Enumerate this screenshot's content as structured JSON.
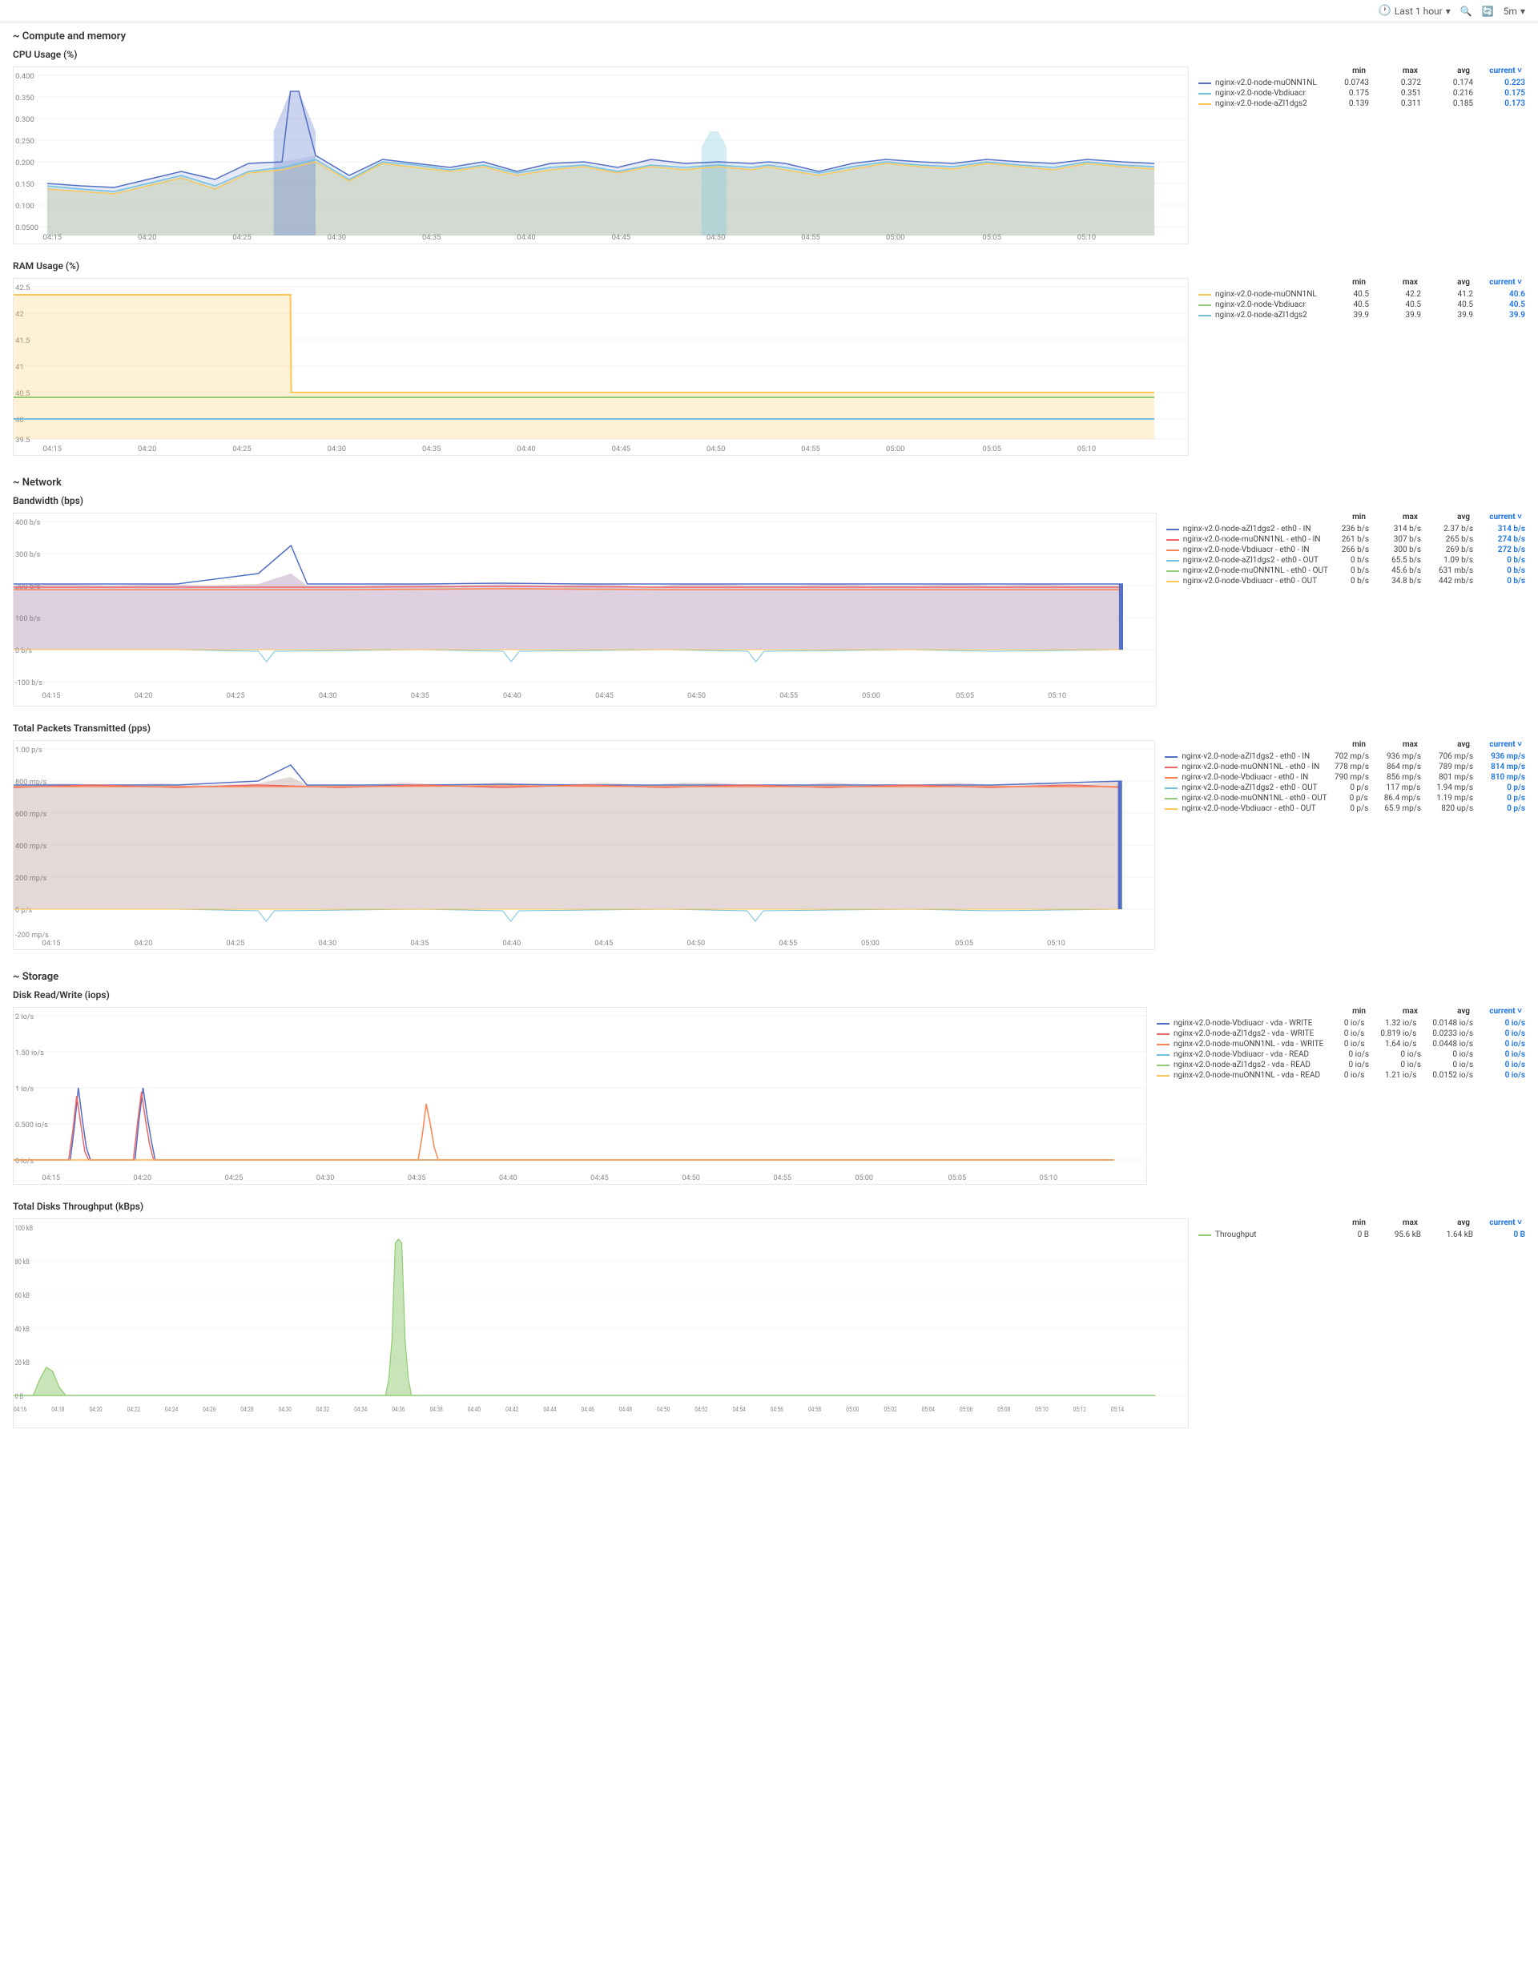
{
  "topbar": {
    "time_icon": "🕐",
    "time_label": "Last 1 hour",
    "search_icon": "🔍",
    "refresh_icon": "🔄",
    "interval_label": "5m",
    "dropdown_icon": "▾"
  },
  "sections": {
    "compute": "~ Compute and memory",
    "network": "~ Network",
    "storage": "~ Storage"
  },
  "cpu": {
    "title": "CPU Usage (%)",
    "y_labels": [
      "0.400",
      "0.350",
      "0.300",
      "0.250",
      "0.200",
      "0.150",
      "0.100",
      "0.0500"
    ],
    "x_labels": [
      "04:15",
      "04:20",
      "04:25",
      "04:30",
      "04:35",
      "04:40",
      "04:45",
      "04:50",
      "04:55",
      "05:00",
      "05:05",
      "05:10"
    ],
    "legend": {
      "headers": [
        "min",
        "max",
        "avg",
        "current ˅"
      ],
      "items": [
        {
          "color": "#5470c6",
          "label": "nginx-v2.0-node-muONN1NL",
          "min": "0.0743",
          "max": "0.372",
          "avg": "0.174",
          "current": "0.223"
        },
        {
          "color": "#73c0de",
          "label": "nginx-v2.0-node-Vbdiuacr",
          "min": "0.175",
          "max": "0.351",
          "avg": "0.216",
          "current": "0.175"
        },
        {
          "color": "#fac858",
          "label": "nginx-v2.0-node-aZl1dgs2",
          "min": "0.139",
          "max": "0.311",
          "avg": "0.185",
          "current": "0.173"
        }
      ]
    }
  },
  "ram": {
    "title": "RAM Usage (%)",
    "y_labels": [
      "42.5",
      "42",
      "41.5",
      "41",
      "40.5",
      "40",
      "39.5"
    ],
    "x_labels": [
      "04:15",
      "04:20",
      "04:25",
      "04:30",
      "04:35",
      "04:40",
      "04:45",
      "04:50",
      "04:55",
      "05:00",
      "05:05",
      "05:10"
    ],
    "legend": {
      "headers": [
        "min",
        "max",
        "avg",
        "current ˅"
      ],
      "items": [
        {
          "color": "#fac858",
          "label": "nginx-v2.0-node-muONN1NL",
          "min": "40.5",
          "max": "42.2",
          "avg": "41.2",
          "current": "40.6"
        },
        {
          "color": "#91cc75",
          "label": "nginx-v2.0-node-Vbdiuacr",
          "min": "40.5",
          "max": "40.5",
          "avg": "40.5",
          "current": "40.5"
        },
        {
          "color": "#73c0de",
          "label": "nginx-v2.0-node-aZl1dgs2",
          "min": "39.9",
          "max": "39.9",
          "avg": "39.9",
          "current": "39.9"
        }
      ]
    }
  },
  "bandwidth": {
    "title": "Bandwidth (bps)",
    "y_labels": [
      "400 b/s",
      "300 b/s",
      "200 b/s",
      "100 b/s",
      "0 b/s",
      "-100 b/s"
    ],
    "x_labels": [
      "04:15",
      "04:20",
      "04:25",
      "04:30",
      "04:35",
      "04:40",
      "04:45",
      "04:50",
      "04:55",
      "05:00",
      "05:05",
      "05:10"
    ],
    "legend": {
      "headers": [
        "min",
        "max",
        "avg",
        "current ˅"
      ],
      "items": [
        {
          "color": "#5470c6",
          "label": "nginx-v2.0-node-aZl1dgs2 - eth0 - IN",
          "min": "236 b/s",
          "max": "314 b/s",
          "avg": "2.37 b/s",
          "current": "314 b/s"
        },
        {
          "color": "#ee6666",
          "label": "nginx-v2.0-node-muONN1NL - eth0 - IN",
          "min": "261 b/s",
          "max": "307 b/s",
          "avg": "265 b/s",
          "current": "274 b/s"
        },
        {
          "color": "#fc8452",
          "label": "nginx-v2.0-node-Vbdiuacr - eth0 - IN",
          "min": "266 b/s",
          "max": "300 b/s",
          "avg": "269 b/s",
          "current": "272 b/s"
        },
        {
          "color": "#73c0de",
          "label": "nginx-v2.0-node-aZl1dgs2 - eth0 - OUT",
          "min": "0 b/s",
          "max": "65.5 b/s",
          "avg": "1.09 b/s",
          "current": "0 b/s"
        },
        {
          "color": "#91cc75",
          "label": "nginx-v2.0-node-muONN1NL - eth0 - OUT",
          "min": "0 b/s",
          "max": "45.6 b/s",
          "avg": "631 mb/s",
          "current": "0 b/s"
        },
        {
          "color": "#fac858",
          "label": "nginx-v2.0-node-Vbdiuacr - eth0 - OUT",
          "min": "0 b/s",
          "max": "34.8 b/s",
          "avg": "442 mb/s",
          "current": "0 b/s"
        }
      ]
    }
  },
  "packets": {
    "title": "Total Packets Transmitted (pps)",
    "y_labels": [
      "1.00 p/s",
      "800 mp/s",
      "600 mp/s",
      "400 mp/s",
      "200 mp/s",
      "0 p/s",
      "-200 mp/s"
    ],
    "x_labels": [
      "04:15",
      "04:20",
      "04:25",
      "04:30",
      "04:35",
      "04:40",
      "04:45",
      "04:50",
      "04:55",
      "05:00",
      "05:05",
      "05:10"
    ],
    "legend": {
      "headers": [
        "min",
        "max",
        "avg",
        "current ˅"
      ],
      "items": [
        {
          "color": "#5470c6",
          "label": "nginx-v2.0-node-aZl1dgs2 - eth0 - IN",
          "min": "702 mp/s",
          "max": "936 mp/s",
          "avg": "706 mp/s",
          "current": "936 mp/s"
        },
        {
          "color": "#ee6666",
          "label": "nginx-v2.0-node-muONN1NL - eth0 - IN",
          "min": "778 mp/s",
          "max": "864 mp/s",
          "avg": "789 mp/s",
          "current": "814 mp/s"
        },
        {
          "color": "#fc8452",
          "label": "nginx-v2.0-node-Vbdiuacr - eth0 - IN",
          "min": "790 mp/s",
          "max": "856 mp/s",
          "avg": "801 mp/s",
          "current": "810 mp/s"
        },
        {
          "color": "#73c0de",
          "label": "nginx-v2.0-node-aZl1dgs2 - eth0 - OUT",
          "min": "0 p/s",
          "max": "117 mp/s",
          "avg": "1.94 mp/s",
          "current": "0 p/s"
        },
        {
          "color": "#91cc75",
          "label": "nginx-v2.0-node-muONN1NL - eth0 - OUT",
          "min": "0 p/s",
          "max": "86.4 mp/s",
          "avg": "1.19 mp/s",
          "current": "0 p/s"
        },
        {
          "color": "#fac858",
          "label": "nginx-v2.0-node-Vbdiuacr - eth0 - OUT",
          "min": "0 p/s",
          "max": "65.9 mp/s",
          "avg": "820 up/s",
          "current": "0 p/s"
        }
      ]
    }
  },
  "disk_io": {
    "title": "Disk Read/Write (iops)",
    "y_labels": [
      "2 io/s",
      "1.50 io/s",
      "1 io/s",
      "0.500 io/s",
      "0 io/s"
    ],
    "x_labels": [
      "04:15",
      "04:20",
      "04:25",
      "04:30",
      "04:35",
      "04:40",
      "04:45",
      "04:50",
      "04:55",
      "05:00",
      "05:05",
      "05:10"
    ],
    "legend": {
      "headers": [
        "min",
        "max",
        "avg",
        "current ˅"
      ],
      "items": [
        {
          "color": "#5470c6",
          "label": "nginx-v2.0-node-Vbdiuacr - vda - WRITE",
          "min": "0 io/s",
          "max": "1.32 io/s",
          "avg": "0.0148 io/s",
          "current": "0 io/s"
        },
        {
          "color": "#ee6666",
          "label": "nginx-v2.0-node-aZl1dgs2 - vda - WRITE",
          "min": "0 io/s",
          "max": "0.819 io/s",
          "avg": "0.0233 io/s",
          "current": "0 io/s"
        },
        {
          "color": "#fc8452",
          "label": "nginx-v2.0-node-muONN1NL - vda - WRITE",
          "min": "0 io/s",
          "max": "1.64 io/s",
          "avg": "0.0448 io/s",
          "current": "0 io/s"
        },
        {
          "color": "#73c0de",
          "label": "nginx-v2.0-node-Vbdiuacr - vda - READ",
          "min": "0 io/s",
          "max": "0 io/s",
          "avg": "0 io/s",
          "current": "0 io/s"
        },
        {
          "color": "#91cc75",
          "label": "nginx-v2.0-node-aZl1dgs2 - vda - READ",
          "min": "0 io/s",
          "max": "0 io/s",
          "avg": "0 io/s",
          "current": "0 io/s"
        },
        {
          "color": "#fac858",
          "label": "nginx-v2.0-node-muONN1NL - vda - READ",
          "min": "0 io/s",
          "max": "1.21 io/s",
          "avg": "0.0152 io/s",
          "current": "0 io/s"
        }
      ]
    }
  },
  "disk_throughput": {
    "title": "Total Disks Throughput (kBps)",
    "y_labels": [
      "100 kB",
      "80 kB",
      "60 kB",
      "40 kB",
      "20 kB",
      "0 B"
    ],
    "x_labels": [
      "04:16",
      "04:18",
      "04:20",
      "04:22",
      "04:24",
      "04:26",
      "04:28",
      "04:30",
      "04:32",
      "04:34",
      "04:36",
      "04:38",
      "04:40",
      "04:42",
      "04:44",
      "04:46",
      "04:48",
      "04:50",
      "04:52",
      "04:54",
      "04:56",
      "04:58",
      "05:00",
      "05:02",
      "05:04",
      "05:06",
      "05:08",
      "05:10",
      "05:12",
      "05:14"
    ],
    "legend": {
      "headers": [
        "min",
        "max",
        "avg",
        "current ˅"
      ],
      "items": [
        {
          "color": "#91cc75",
          "label": "Throughput",
          "min": "0 B",
          "max": "95.6 kB",
          "avg": "1.64 kB",
          "current": "0 B"
        }
      ]
    }
  }
}
